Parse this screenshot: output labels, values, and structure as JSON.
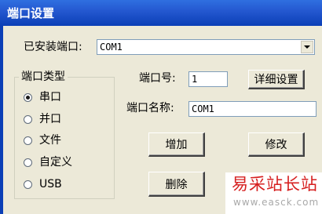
{
  "window": {
    "title": "端口设置"
  },
  "installed": {
    "label": "已安装端口:",
    "value": "COM1"
  },
  "port_type": {
    "title": "端口类型",
    "options": [
      "串口",
      "并口",
      "文件",
      "自定义",
      "USB"
    ],
    "selected": "串口"
  },
  "port_number": {
    "label": "端口号:",
    "value": "1"
  },
  "detail_button": "详细设置",
  "port_name": {
    "label": "端口名称:",
    "value": "COM1"
  },
  "buttons": {
    "add": "增加",
    "modify": "修改",
    "delete": "删除"
  },
  "watermark": {
    "main": "易采站长站",
    "url": "www.easck.com"
  }
}
